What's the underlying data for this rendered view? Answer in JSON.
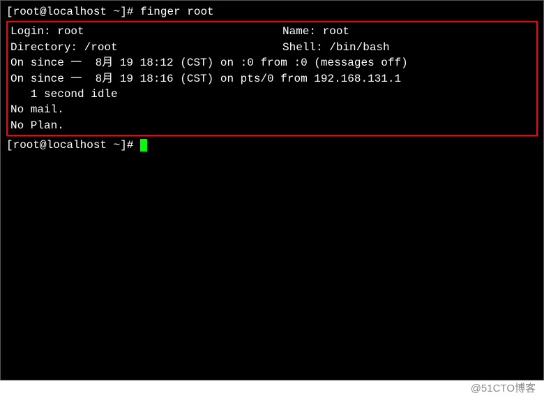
{
  "prompt1": "[root@localhost ~]# ",
  "command": "finger root",
  "output": {
    "login_label": "Login: ",
    "login_value": "root",
    "name_label": "Name: ",
    "name_value": "root",
    "dir_label": "Directory: ",
    "dir_value": "/root",
    "shell_label": "Shell: ",
    "shell_value": "/bin/bash",
    "session1": "On since 一  8月 19 18:12 (CST) on :0 from :0 (messages off)",
    "session2": "On since 一  8月 19 18:16 (CST) on pts/0 from 192.168.131.1",
    "idle": "   1 second idle",
    "mail": "No mail.",
    "plan": "No Plan."
  },
  "prompt2": "[root@localhost ~]# ",
  "watermark": "@51CTO博客"
}
